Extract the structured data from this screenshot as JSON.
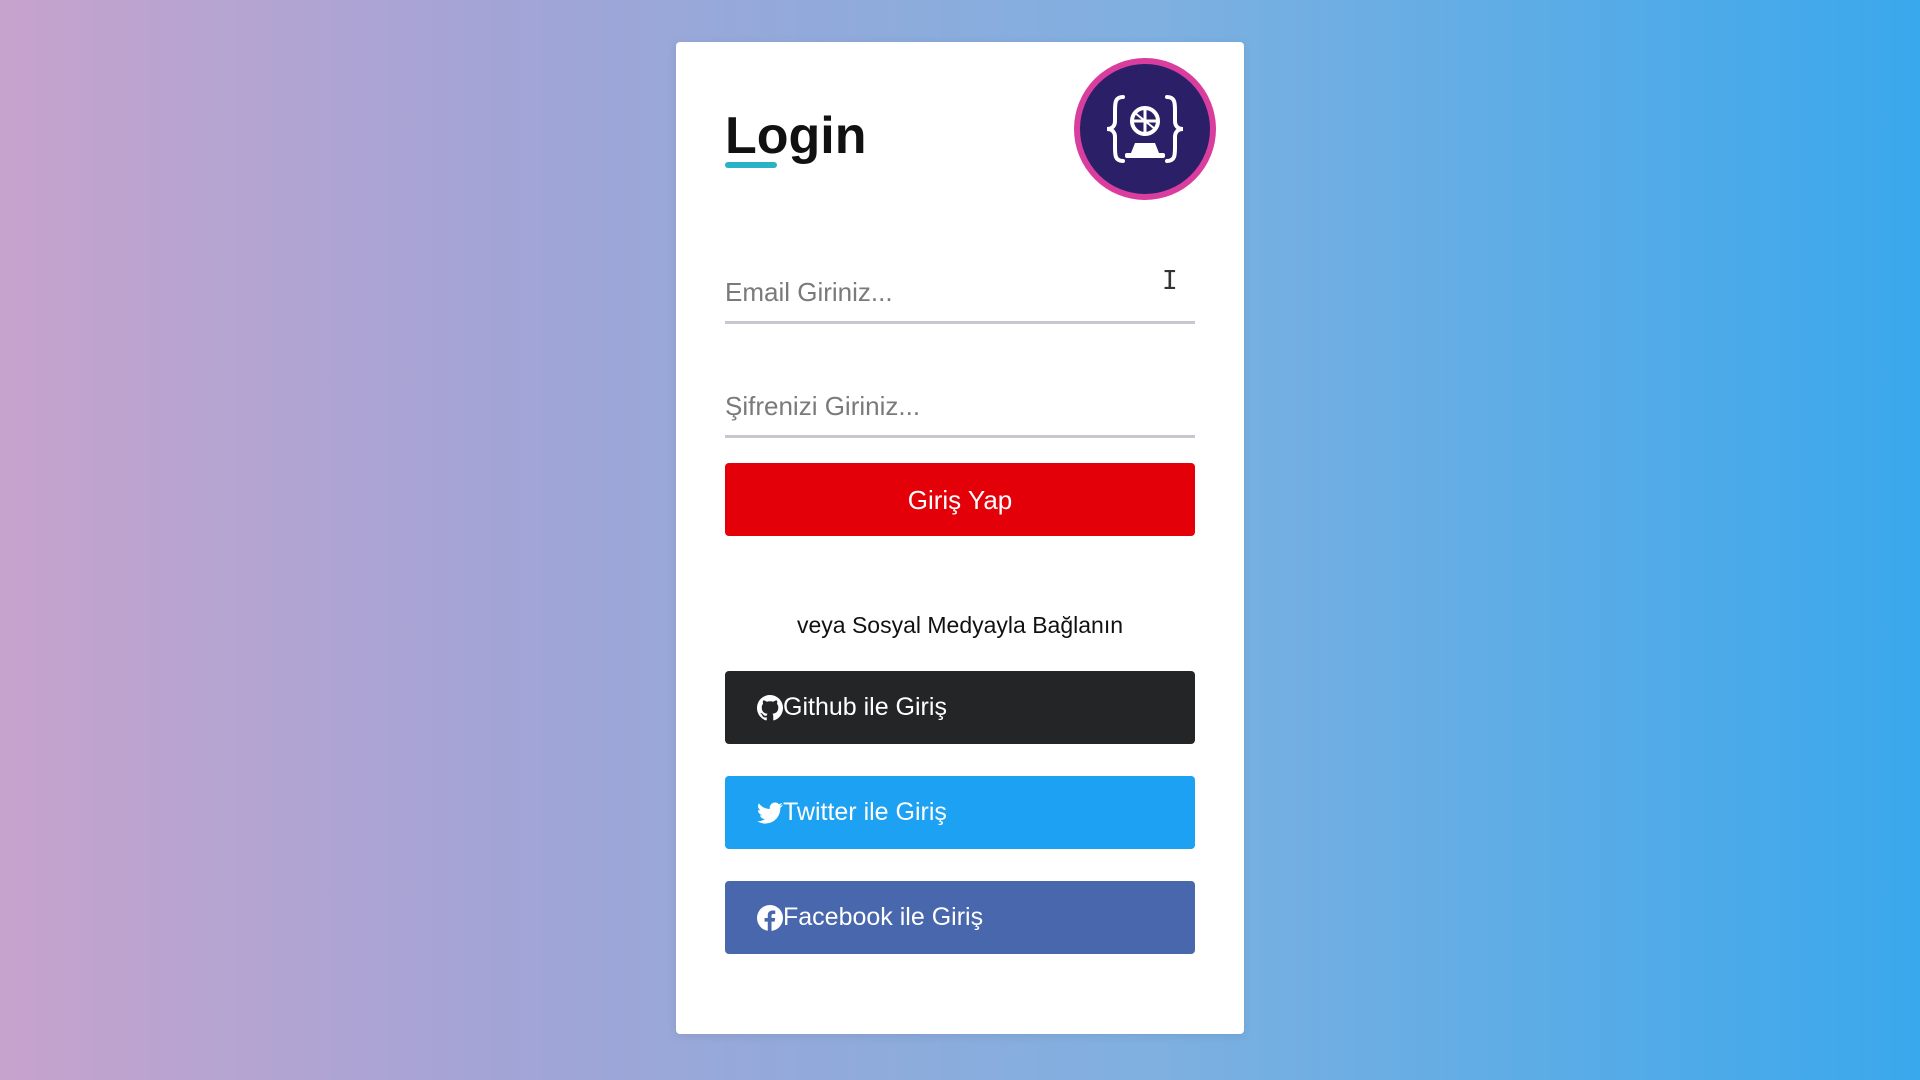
{
  "login": {
    "title": "Login",
    "email_placeholder": "Email Giriniz...",
    "password_placeholder": "Şifrenizi Giriniz...",
    "submit_label": "Giriş Yap",
    "social_text": "veya Sosyal Medyayla Bağlanın",
    "github_label": "Github ile Giriş",
    "twitter_label": "Twitter ile Giriş",
    "facebook_label": "Facebook ile Giriş"
  },
  "colors": {
    "submit": "#e30008",
    "github": "#242526",
    "twitter": "#1da1f2",
    "facebook": "#4967ad",
    "logo_bg": "#2b2068",
    "logo_ring": "#d93e9e",
    "title_underline": "#2ab3c6"
  },
  "icons": {
    "logo": "code-brackets-logo-icon",
    "github": "github-icon",
    "twitter": "twitter-icon",
    "facebook": "facebook-icon",
    "cursor": "text-cursor-icon"
  }
}
